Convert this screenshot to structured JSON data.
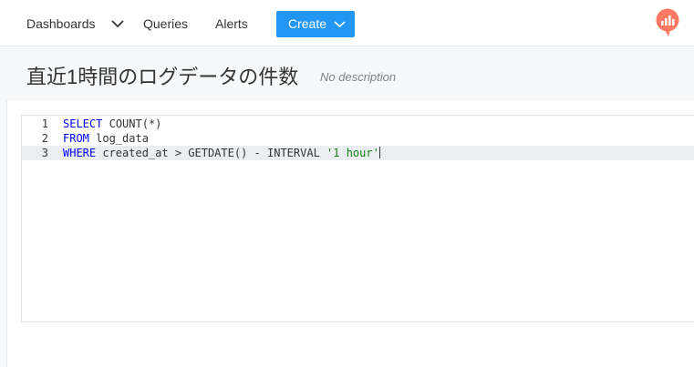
{
  "nav": {
    "dashboards_label": "Dashboards",
    "queries_label": "Queries",
    "alerts_label": "Alerts",
    "create_label": "Create"
  },
  "query": {
    "title": "直近1時間のログデータの件数",
    "description": "No description"
  },
  "editor": {
    "line_numbers": [
      "1",
      "2",
      "3"
    ],
    "lines": [
      {
        "parts": [
          {
            "t": "kw",
            "v": "SELECT"
          },
          {
            "t": "plain",
            "v": " "
          },
          {
            "t": "fn",
            "v": "COUNT"
          },
          {
            "t": "plain",
            "v": "(*)"
          }
        ]
      },
      {
        "parts": [
          {
            "t": "kw",
            "v": "FROM"
          },
          {
            "t": "plain",
            "v": " log_data"
          }
        ]
      },
      {
        "parts": [
          {
            "t": "kw",
            "v": "WHERE"
          },
          {
            "t": "plain",
            "v": " created_at "
          },
          {
            "t": "op",
            "v": ">"
          },
          {
            "t": "plain",
            "v": " GETDATE() "
          },
          {
            "t": "op",
            "v": "-"
          },
          {
            "t": "plain",
            "v": " INTERVAL "
          },
          {
            "t": "str",
            "v": "'1 hour'"
          }
        ]
      }
    ],
    "active_line": 3
  },
  "colors": {
    "accent": "#2196f3",
    "logo": "#ff7964",
    "keyword": "#0000ff",
    "string": "#0f7c0f"
  },
  "icons": {
    "dropdown": "chevron-down-icon",
    "logo": "redash-logo-icon"
  }
}
